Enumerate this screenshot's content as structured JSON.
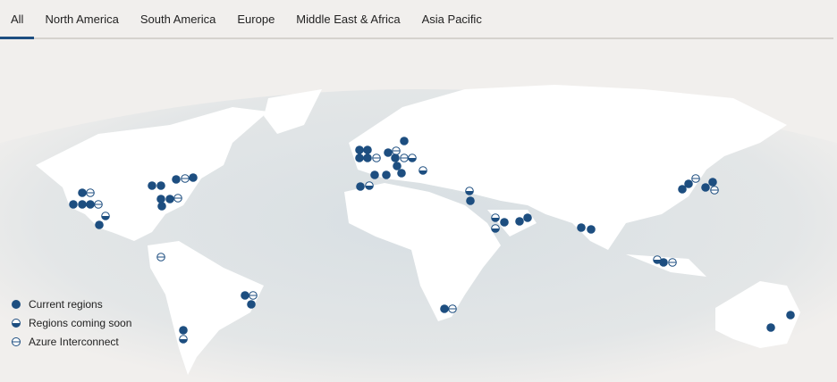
{
  "tabs": [
    {
      "label": "All",
      "active": true
    },
    {
      "label": "North America"
    },
    {
      "label": "South America"
    },
    {
      "label": "Europe"
    },
    {
      "label": "Middle East & Africa"
    },
    {
      "label": "Asia Pacific"
    }
  ],
  "legend": {
    "current": "Current regions",
    "soon": "Regions coming soon",
    "interconnect": "Azure Interconnect"
  },
  "colors": {
    "marker": "#1d4e80",
    "accent": "#1d4e80"
  }
}
